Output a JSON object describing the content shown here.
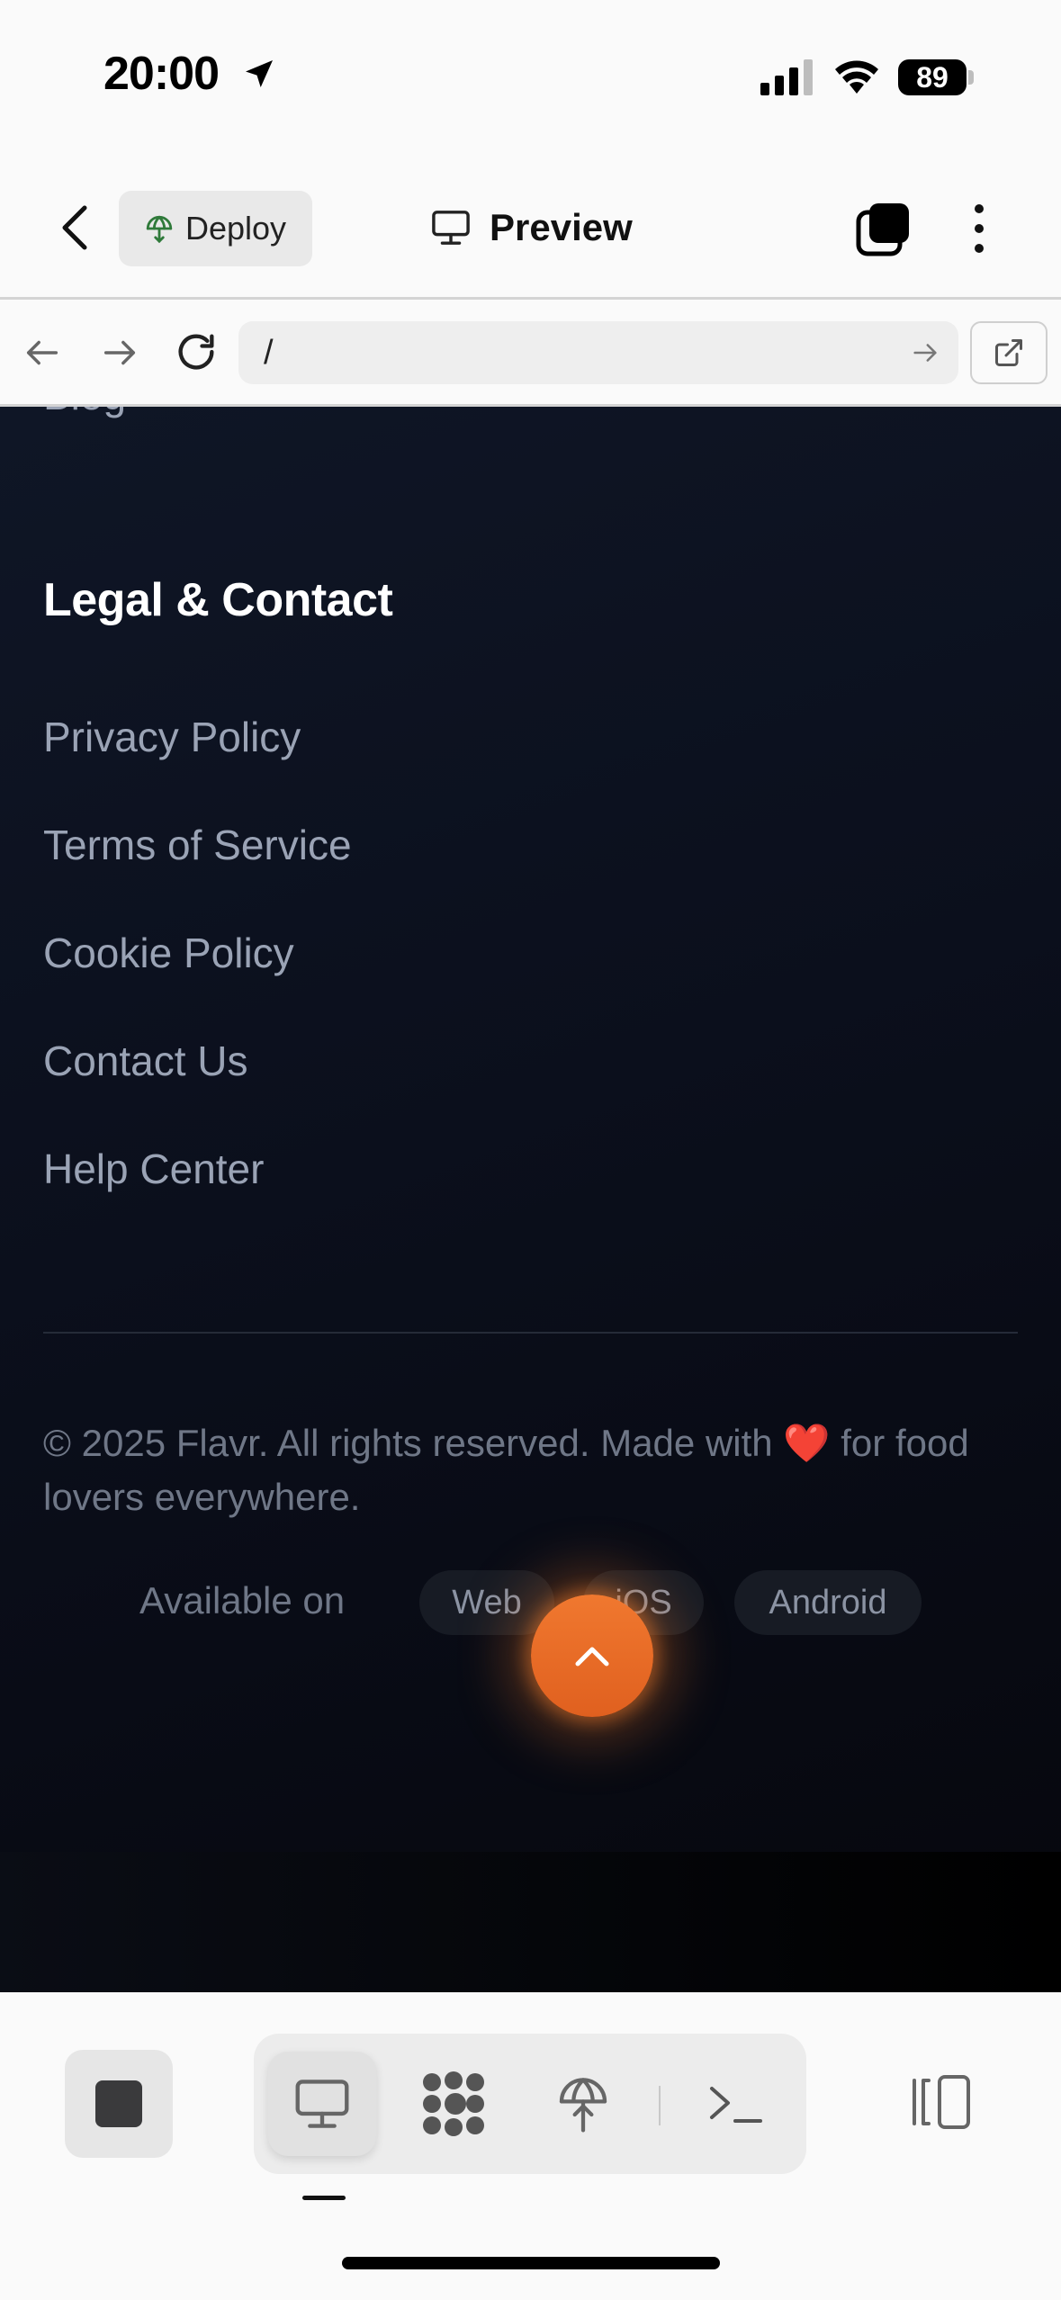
{
  "status_bar": {
    "time": "20:00",
    "battery": "89"
  },
  "header": {
    "deploy_label": "Deploy",
    "preview_label": "Preview"
  },
  "url_bar": {
    "url": "/"
  },
  "content": {
    "blog_link": "Blog",
    "section_title": "Legal & Contact",
    "links": [
      "Privacy Policy",
      "Terms of Service",
      "Cookie Policy",
      "Contact Us",
      "Help Center"
    ],
    "copyright": "© 2025 Flavr. All rights reserved. Made with ❤️ for food lovers everywhere.",
    "available_label": "Available on",
    "platforms": [
      "Web",
      "iOS",
      "Android"
    ]
  },
  "colors": {
    "accent": "#ef7430",
    "background": "#0b0f1c"
  }
}
